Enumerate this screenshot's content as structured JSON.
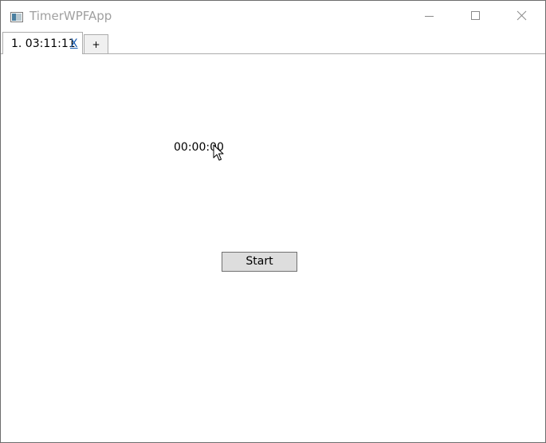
{
  "window": {
    "title": "TimerWPFApp",
    "icon": "app-window-icon",
    "controls": {
      "minimize_icon": "minimize-icon",
      "maximize_icon": "maximize-icon",
      "close_icon": "close-icon"
    }
  },
  "tabs": {
    "items": [
      {
        "label": "1. 03:11:11",
        "close_label": "X",
        "selected": true
      }
    ],
    "add_label": "+"
  },
  "main": {
    "timer_text": "00:00:00",
    "start_label": "Start"
  },
  "colors": {
    "title_text": "#a0a0a0",
    "link": "#1a5fb4",
    "button_bg": "#dddddd",
    "tab_add_bg": "#f0f0f0"
  }
}
